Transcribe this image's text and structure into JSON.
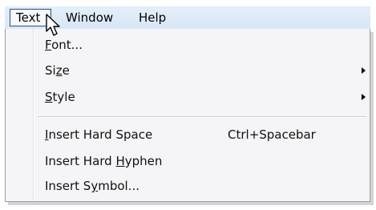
{
  "menubar": {
    "items": [
      {
        "label": "Text",
        "active": true
      },
      {
        "label": "Window",
        "active": false
      },
      {
        "label": "Help",
        "active": false
      }
    ]
  },
  "menu": {
    "items": [
      {
        "pre": "",
        "mn": "F",
        "post": "ont...",
        "shortcut": "",
        "submenu": false
      },
      {
        "pre": "Si",
        "mn": "z",
        "post": "e",
        "shortcut": "",
        "submenu": true
      },
      {
        "pre": "",
        "mn": "S",
        "post": "tyle",
        "shortcut": "",
        "submenu": true
      },
      {
        "pre": "",
        "mn": "I",
        "post": "nsert Hard Space",
        "shortcut": "Ctrl+Spacebar",
        "submenu": false
      },
      {
        "pre": "Insert Hard ",
        "mn": "H",
        "post": "yphen",
        "shortcut": "",
        "submenu": false
      },
      {
        "pre": "Insert S",
        "mn": "y",
        "post": "mbol...",
        "shortcut": "",
        "submenu": false
      }
    ]
  },
  "colors": {
    "menubar_bg": "#dce9f7",
    "active_border": "#2b4f86",
    "menu_bg": "#f5f5f7"
  },
  "icons": {
    "cursor": "mouse-pointer-icon",
    "submenu_arrow": "submenu-arrow-icon"
  }
}
